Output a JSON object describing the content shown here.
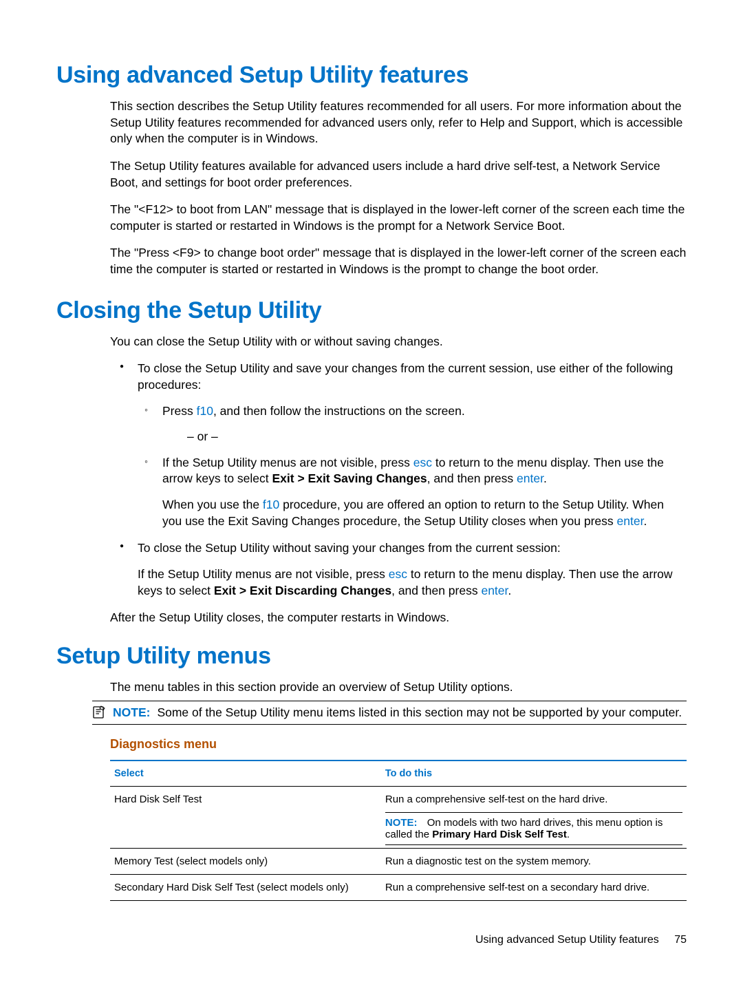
{
  "section1": {
    "heading": "Using advanced Setup Utility features",
    "p1": "This section describes the Setup Utility features recommended for all users. For more information about the Setup Utility features recommended for advanced users only, refer to Help and Support, which is accessible only when the computer is in Windows.",
    "p2": "The Setup Utility features available for advanced users include a hard drive self-test, a Network Service Boot, and settings for boot order preferences.",
    "p3": "The \"<F12> to boot from LAN\" message that is displayed in the lower-left corner of the screen each time the computer is started or restarted in Windows is the prompt for a Network Service Boot.",
    "p4": "The \"Press <F9> to change boot order\" message that is displayed in the lower-left corner of the screen each time the computer is started or restarted in Windows is the prompt to change the boot order."
  },
  "section2": {
    "heading": "Closing the Setup Utility",
    "intro": "You can close the Setup Utility with or without saving changes.",
    "b1_lead": "To close the Setup Utility and save your changes from the current session, use either of the following procedures:",
    "sub1_pre": "Press ",
    "sub1_key": "f10",
    "sub1_post": ", and then follow the instructions on the screen.",
    "or": "– or –",
    "sub2_pre": "If the Setup Utility menus are not visible, press ",
    "sub2_key1": "esc",
    "sub2_mid": " to return to the menu display. Then use the arrow keys to select ",
    "sub2_bold": "Exit > Exit Saving Changes",
    "sub2_mid2": ", and then press ",
    "sub2_key2": "enter",
    "sub2_end": ".",
    "sub2_extra_pre": "When you use the ",
    "sub2_extra_key": "f10",
    "sub2_extra_mid": " procedure, you are offered an option to return to the Setup Utility. When you use the Exit Saving Changes procedure, the Setup Utility closes when you press ",
    "sub2_extra_key2": "enter",
    "sub2_extra_end": ".",
    "b2_lead": "To close the Setup Utility without saving your changes from the current session:",
    "b2_p_pre": "If the Setup Utility menus are not visible, press ",
    "b2_p_key1": "esc",
    "b2_p_mid": " to return to the menu display. Then use the arrow keys to select ",
    "b2_p_bold": "Exit > Exit Discarding Changes",
    "b2_p_mid2": ", and then press ",
    "b2_p_key2": "enter",
    "b2_p_end": ".",
    "after": "After the Setup Utility closes, the computer restarts in Windows."
  },
  "section3": {
    "heading": "Setup Utility menus",
    "intro": "The menu tables in this section provide an overview of Setup Utility options.",
    "note_label": "NOTE:",
    "note_text": "Some of the Setup Utility menu items listed in this section may not be supported by your computer.",
    "subhead": "Diagnostics menu",
    "table": {
      "col1": "Select",
      "col2": "To do this",
      "rows": [
        {
          "select": "Hard Disk Self Test",
          "do": "Run a comprehensive self-test on the hard drive.",
          "note_label": "NOTE:",
          "note_pre": "On models with two hard drives, this menu option is called the ",
          "note_bold": "Primary Hard Disk Self Test",
          "note_end": "."
        },
        {
          "select": "Memory Test (select models only)",
          "do": "Run a diagnostic test on the system memory."
        },
        {
          "select": "Secondary Hard Disk Self Test (select models only)",
          "do": "Run a comprehensive self-test on a secondary hard drive."
        }
      ]
    }
  },
  "footer": {
    "text": "Using advanced Setup Utility features",
    "page": "75"
  }
}
